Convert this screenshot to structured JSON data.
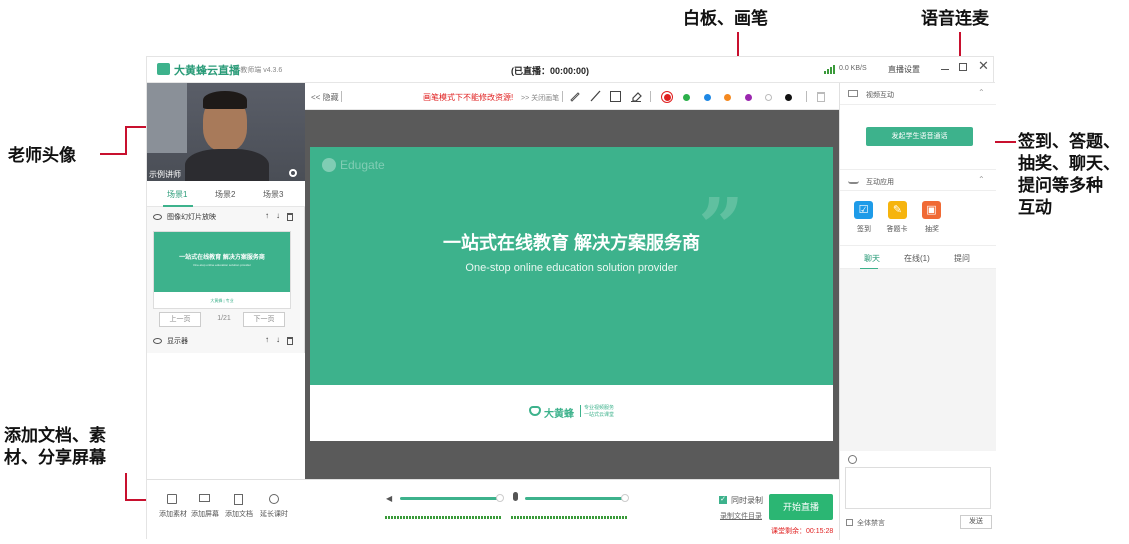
{
  "annotations": {
    "whiteboard": "白板、画笔",
    "voice": "语音连麦",
    "teacher_avatar": "老师头像",
    "interaction": [
      "签到、答题、",
      "抽奖、聊天、",
      "提问等多种",
      "互动"
    ],
    "add_docs": [
      "添加文档、素",
      "材、分享屏幕"
    ]
  },
  "titlebar": {
    "app_name": "大黄蜂云直播",
    "version": "- 教师端 v4.3.6",
    "status": "(已直播：00:00:00)",
    "network": "0.0 KB/S",
    "settings": "直播设置"
  },
  "left": {
    "camera_label": "示例讲师",
    "scenes": [
      "场景1",
      "场景2",
      "场景3"
    ],
    "layer1": "图像幻灯片放映",
    "thumb_title": "一站式在线教育 解决方案服务商",
    "thumb_sub": "One-stop online education solution provider",
    "thumb_logo": "大黄蜂 | 专业",
    "prev": "上一页",
    "page": "1/21",
    "next": "下一页",
    "layer2": "显示器"
  },
  "toolbar": {
    "hide": "<< 隐藏",
    "warning": "画笔模式下不能修改资源!",
    "close_brush": ">> 关闭画笔"
  },
  "slide": {
    "watermark": "Edugate",
    "title": "一站式在线教育 解决方案服务商",
    "subtitle": "One-stop online education solution provider",
    "brand": "大黄蜂",
    "tagline1": "专业视频服务",
    "tagline2": "一站式云课堂"
  },
  "right": {
    "video_section": "视频互动",
    "voice_button": "发起学生语音通话",
    "apps_section": "互动应用",
    "apps": [
      "签到",
      "答题卡",
      "抽奖"
    ],
    "tabs": [
      "聊天",
      "在线(1)",
      "提问"
    ],
    "mute_all": "全体禁言",
    "send": "发送"
  },
  "bottom": {
    "tools": [
      "添加素材",
      "添加屏幕",
      "添加文档",
      "延长课时"
    ],
    "record": "同时录制",
    "record_dir": "录制文件目录",
    "start": "开始直播",
    "remaining": "课堂剩余：00:15:28"
  },
  "colors": {
    "brand_green": "#3db28c",
    "start_green": "#2bb673",
    "pen_colors": [
      "#e02020",
      "#2bb04a",
      "#1e88e5",
      "#f5891f",
      "#9b27af",
      "#ffffff",
      "#111111"
    ]
  }
}
